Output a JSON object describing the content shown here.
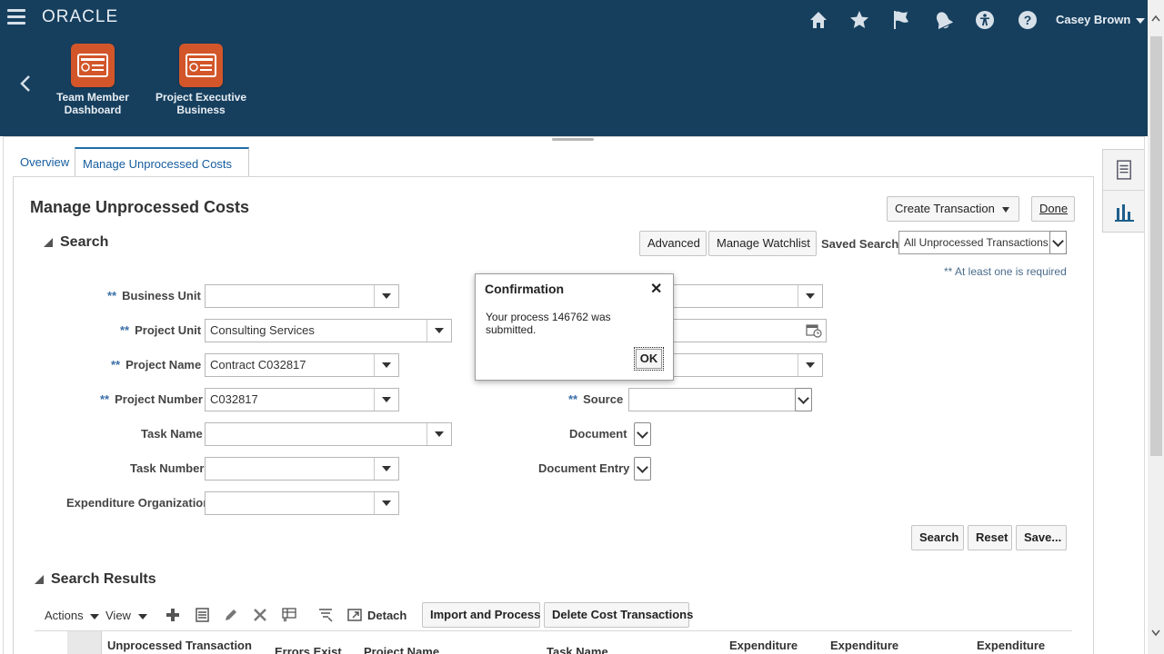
{
  "header": {
    "logo": "ORACLE",
    "user_name": "Casey Brown",
    "icons": [
      "home-icon",
      "favorites-star-icon",
      "watchlist-flag-icon",
      "notifications-bell-icon",
      "accessibility-icon",
      "help-icon"
    ]
  },
  "springboard": {
    "items": [
      {
        "label": "Team Member Dashboard"
      },
      {
        "label": "Project Executive Business"
      }
    ]
  },
  "tabs": [
    {
      "label": "Overview"
    },
    {
      "label": "Manage Unprocessed Costs"
    }
  ],
  "page": {
    "title": "Manage Unprocessed Costs",
    "create_transaction": "Create Transaction",
    "done": "Done"
  },
  "search": {
    "header": "Search",
    "advanced": "Advanced",
    "manage_watchlist": "Manage Watchlist",
    "saved_search_label": "Saved Search",
    "saved_search_value": "All Unprocessed Transactions",
    "required_note": "** At least one is required",
    "required_marker": "**",
    "fields": {
      "business_unit": {
        "label": "Business Unit",
        "value": ""
      },
      "project_unit": {
        "label": "Project Unit",
        "value": "Consulting Services"
      },
      "project_name": {
        "label": "Project Name",
        "value": "Contract C032817"
      },
      "project_number": {
        "label": "Project Number",
        "value": "C032817"
      },
      "task_name": {
        "label": "Task Name",
        "value": ""
      },
      "task_number": {
        "label": "Task Number",
        "value": ""
      },
      "expenditure_org": {
        "label": "Expenditure Organization",
        "value": ""
      },
      "source": {
        "label": "Source",
        "value": ""
      },
      "document": {
        "label": "Document",
        "value": ""
      },
      "document_entry": {
        "label": "Document Entry",
        "value": ""
      }
    },
    "search_btn": "Search",
    "reset_btn": "Reset",
    "save_btn": "Save..."
  },
  "results": {
    "header": "Search Results",
    "actions": "Actions",
    "view": "View",
    "detach": "Detach",
    "import_process": "Import and Process",
    "delete_cost": "Delete Cost Transactions",
    "columns": [
      "Unprocessed Transaction",
      "Errors Exist",
      "Project Name",
      "Task Name",
      "Expenditure",
      "Expenditure",
      "Expenditure"
    ]
  },
  "dialog": {
    "title": "Confirmation",
    "message": "Your process 146762 was submitted.",
    "ok": "OK"
  }
}
